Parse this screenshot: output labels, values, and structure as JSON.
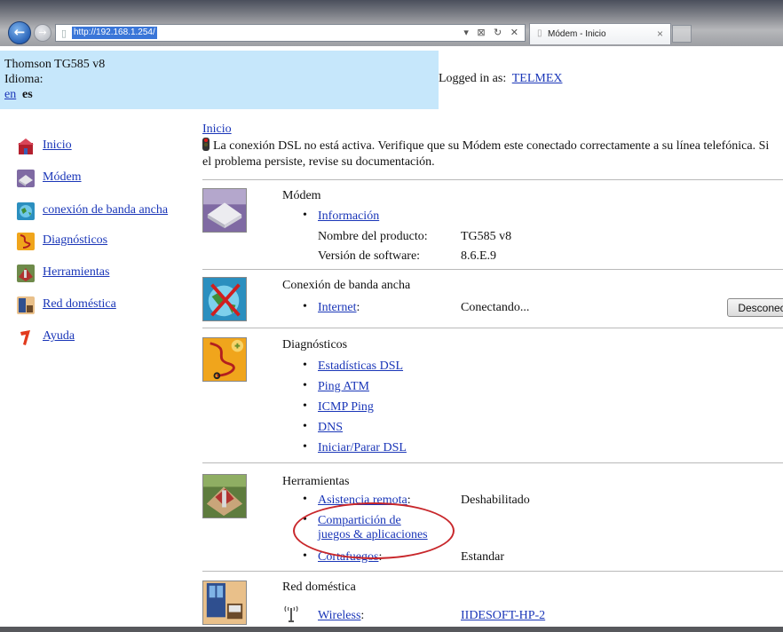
{
  "browser": {
    "url": "http://192.168.1.254/",
    "address_controls": "▾ ⊠ ↻ ✕",
    "tab_title": "Módem - Inicio",
    "tab_close": "×"
  },
  "header": {
    "device": "Thomson TG585 v8",
    "language_label": "Idioma:",
    "lang_en": "en",
    "lang_es": "es",
    "logged_in_label": "Logged in as:",
    "user": "TELMEX"
  },
  "sidebar": {
    "items": [
      {
        "label": "Inicio",
        "icon": "home-icon",
        "color": "#b3202e"
      },
      {
        "label": "Módem",
        "icon": "modem-icon",
        "color": "#7f6aa3"
      },
      {
        "label": "conexión de banda ancha",
        "icon": "globe-icon",
        "color": "#2b8fbf"
      },
      {
        "label": "Diagnósticos",
        "icon": "diagnostics-icon",
        "color": "#f0a51c"
      },
      {
        "label": "Herramientas",
        "icon": "tools-icon",
        "color": "#b0322f"
      },
      {
        "label": "Red doméstica",
        "icon": "home-network-icon",
        "color": "#2f4f8f"
      },
      {
        "label": "Ayuda",
        "icon": "help-icon",
        "color": "#e13a1d"
      }
    ]
  },
  "main": {
    "breadcrumb": "Inicio",
    "alert": "La conexión DSL no está activa. Verifique que su Módem este conectado correctamente a su línea telefónica. Si el problema persiste, revise su documentación.",
    "modem": {
      "title": "Módem",
      "link": "Información",
      "product_label": "Nombre del producto:",
      "product_value": "TG585 v8",
      "software_label": "Versión de software:",
      "software_value": "8.6.E.9"
    },
    "broadband": {
      "title": "Conexión de banda ancha",
      "link": "Internet",
      "colon": ":",
      "status": "Conectando...",
      "button": "Desconectar"
    },
    "diagnostics": {
      "title": "Diagnósticos",
      "links": [
        "Estadísticas DSL",
        "Ping ATM",
        "ICMP Ping",
        "DNS",
        "Iniciar/Parar DSL"
      ]
    },
    "tools": {
      "title": "Herramientas",
      "remote_link": "Asistencia remota",
      "remote_colon": ":",
      "remote_value": "Deshabilitado",
      "games_link_line1": "Compartición de",
      "games_link_line2": "juegos & aplicaciones",
      "firewall_link": "Cortafuegos",
      "firewall_colon": ":",
      "firewall_value": "Estandar"
    },
    "home_network": {
      "title": "Red doméstica",
      "wireless_link": "Wireless",
      "wireless_colon": ":",
      "ssid": "IIDESOFT-HP-2"
    }
  }
}
